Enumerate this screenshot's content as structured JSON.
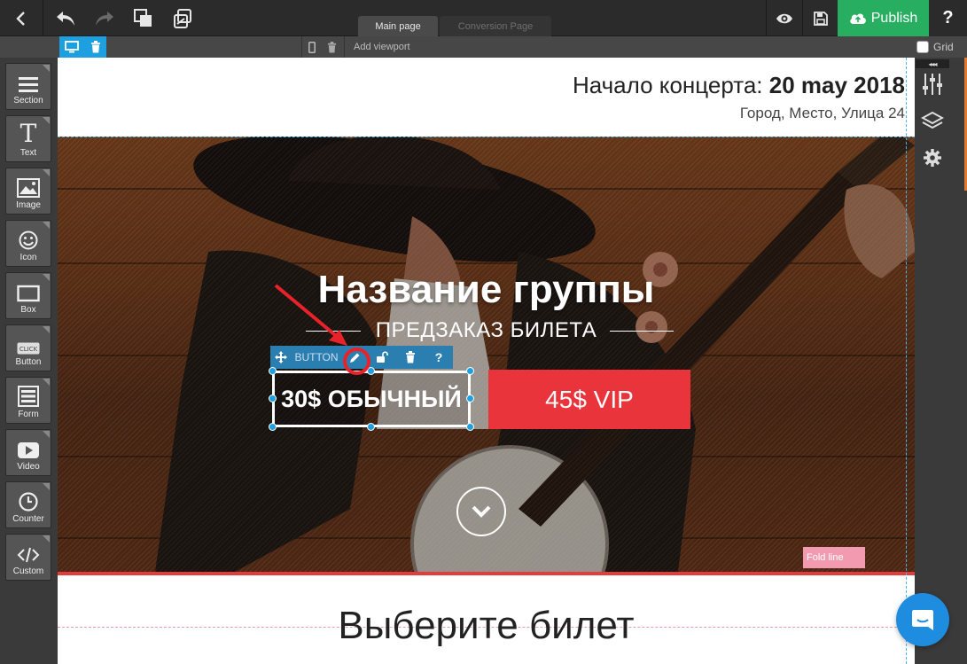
{
  "topbar": {
    "tabs": [
      {
        "label": "Main page",
        "active": true
      },
      {
        "label": "Conversion Page",
        "active": false
      }
    ],
    "publish_label": "Publish",
    "help_label": "?"
  },
  "viewport_bar": {
    "add_viewport_label": "Add viewport",
    "grid_label": "Grid"
  },
  "tools": [
    {
      "label": "Section",
      "icon": "hamburger-icon"
    },
    {
      "label": "Text",
      "icon": "text-t-icon"
    },
    {
      "label": "Image",
      "icon": "image-icon"
    },
    {
      "label": "Icon",
      "icon": "smiley-icon"
    },
    {
      "label": "Box",
      "icon": "box-icon"
    },
    {
      "label": "Button",
      "icon": "click-button-icon"
    },
    {
      "label": "Form",
      "icon": "form-icon"
    },
    {
      "label": "Video",
      "icon": "video-play-icon"
    },
    {
      "label": "Counter",
      "icon": "clock-icon"
    },
    {
      "label": "Custom",
      "icon": "code-icon"
    }
  ],
  "page": {
    "header_date_prefix": "Начало концерта: ",
    "header_date_value": "20 may 2018",
    "header_address": "Город, Место, Улица 24",
    "band_title": "Название группы",
    "band_subtitle": "ПРЕДЗАКАЗ БИЛЕТА",
    "button_toolbar_label": "BUTTON",
    "button_regular": "30$ ОБЫЧНЫЙ",
    "button_vip": "45$ VIP",
    "section_title": "Выберите билет",
    "fold_label": "Fold line"
  },
  "colors": {
    "publish": "#27ae60",
    "accent_blue": "#1ea0e0",
    "vip_red": "#e8343a",
    "chat_blue": "#1e8de0"
  }
}
